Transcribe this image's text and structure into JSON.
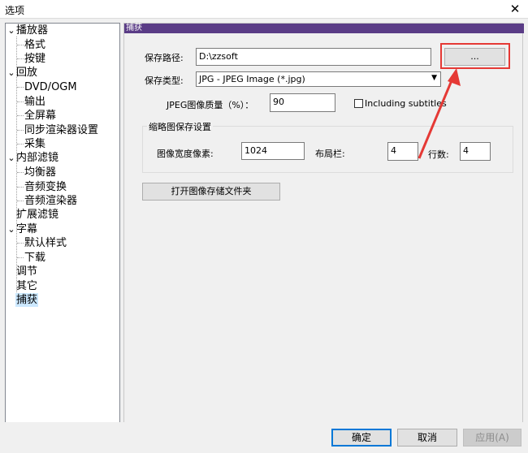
{
  "window": {
    "title": "选项"
  },
  "tree": {
    "items": [
      {
        "label": "播放器",
        "toggle": "⌄"
      },
      {
        "label": "格式"
      },
      {
        "label": "按键"
      },
      {
        "label": "回放",
        "toggle": "⌄"
      },
      {
        "label": "DVD/OGM"
      },
      {
        "label": "输出"
      },
      {
        "label": "全屏幕"
      },
      {
        "label": "同步渲染器设置"
      },
      {
        "label": "采集"
      },
      {
        "label": "内部滤镜",
        "toggle": "⌄"
      },
      {
        "label": "均衡器"
      },
      {
        "label": "音频变换"
      },
      {
        "label": "音频渲染器"
      },
      {
        "label": "扩展滤镜"
      },
      {
        "label": "字幕",
        "toggle": "⌄"
      },
      {
        "label": "默认样式"
      },
      {
        "label": "下载"
      },
      {
        "label": "调节"
      },
      {
        "label": "其它"
      },
      {
        "label": "捕获",
        "selected": true
      }
    ]
  },
  "panel": {
    "header": "捕获",
    "save_path_label": "保存路径:",
    "save_path_value": "D:\\zzsoft",
    "browse_button": "...",
    "save_type_label": "保存类型:",
    "save_type_value": "JPG - JPEG Image (*.jpg)",
    "jpeg_quality_label": "JPEG图像质量（%）：",
    "jpeg_quality_value": "90",
    "including_subtitles_label": "Including subtitles",
    "thumbnail_group_title": "缩略图保存设置",
    "image_width_label": "图像宽度像素:",
    "image_width_value": "1024",
    "layout_columns_label": "布局栏:",
    "layout_columns_value": "4",
    "rows_label": "行数:",
    "rows_value": "4",
    "open_folder_button": "打开图像存储文件夹"
  },
  "footer": {
    "ok": "确定",
    "cancel": "取消",
    "apply": "应用(A)"
  },
  "colors": {
    "header_bg": "#5a3c86",
    "annotation": "#e53935",
    "selection": "#cce8ff"
  }
}
